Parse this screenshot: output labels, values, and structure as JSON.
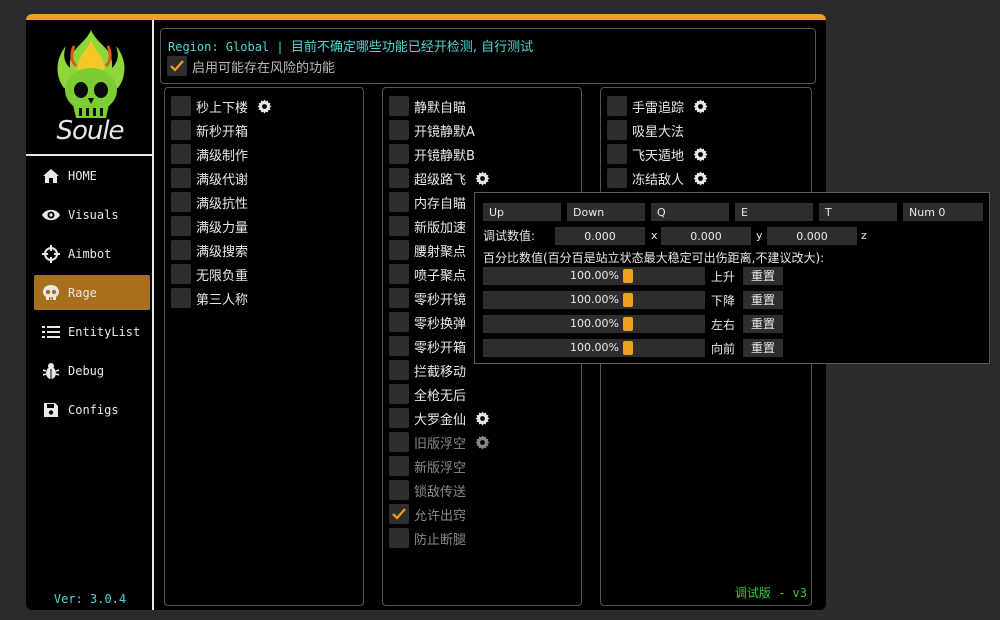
{
  "app": {
    "logo_text": "Soule",
    "version": "Ver: 3.0.4",
    "accent_color": "#f0a020",
    "cyan_color": "#4fd6d6"
  },
  "nav": [
    {
      "label": "HOME",
      "icon": "home-icon",
      "active": false
    },
    {
      "label": "Visuals",
      "icon": "eye-icon",
      "active": false
    },
    {
      "label": "Aimbot",
      "icon": "crosshair-icon",
      "active": false
    },
    {
      "label": "Rage",
      "icon": "skull-icon",
      "active": true
    },
    {
      "label": "EntityList",
      "icon": "list-icon",
      "active": false
    },
    {
      "label": "Debug",
      "icon": "bug-icon",
      "active": false
    },
    {
      "label": "Configs",
      "icon": "save-icon",
      "active": false
    }
  ],
  "header": {
    "region": "Region: Global",
    "separator": " | ",
    "notice": "目前不确定哪些功能已经开检测, 自行测试",
    "risk_label": "启用可能存在风险的功能",
    "risk_checked": true
  },
  "col1": [
    {
      "label": "秒上下楼",
      "gear": true
    },
    {
      "label": "新秒开箱"
    },
    {
      "label": "满级制作"
    },
    {
      "label": "满级代谢"
    },
    {
      "label": "满级抗性"
    },
    {
      "label": "满级力量"
    },
    {
      "label": "满级搜索"
    },
    {
      "label": "无限负重"
    },
    {
      "label": "第三人称"
    }
  ],
  "col2": [
    {
      "label": "静默自瞄"
    },
    {
      "label": "开镜静默A"
    },
    {
      "label": "开镜静默B"
    },
    {
      "label": "超级路飞",
      "gear": true
    },
    {
      "label": "内存自瞄"
    },
    {
      "label": "新版加速"
    },
    {
      "label": "腰射聚点"
    },
    {
      "label": "喷子聚点"
    },
    {
      "label": "零秒开镜"
    },
    {
      "label": "零秒换弹"
    },
    {
      "label": "零秒开箱"
    },
    {
      "label": "拦截移动"
    },
    {
      "label": "全枪无后"
    },
    {
      "label": "大罗金仙",
      "gear": true
    },
    {
      "label": "旧版浮空",
      "gear": true,
      "disabled": true
    },
    {
      "label": "新版浮空",
      "disabled": true
    },
    {
      "label": "锁敌传送",
      "disabled": true
    },
    {
      "label": "允许出窍",
      "disabled": true,
      "checked": true
    },
    {
      "label": "防止断腿",
      "disabled": true
    }
  ],
  "col3": [
    {
      "label": "手雷追踪",
      "gear": true
    },
    {
      "label": "吸星大法"
    },
    {
      "label": "飞天遁地",
      "gear": true
    },
    {
      "label": "冻结敌人",
      "gear": true
    }
  ],
  "col3_footer": "调试版 - v3",
  "popup": {
    "keys": [
      "Up",
      "Down",
      "Q",
      "E",
      "T",
      "Num 0"
    ],
    "debug_label": "调试数值:",
    "debug_values": [
      {
        "value": "0.000",
        "axis": "x"
      },
      {
        "value": "0.000",
        "axis": "y"
      },
      {
        "value": "0.000",
        "axis": "z"
      }
    ],
    "percent_label": "百分比数值(百分百是站立状态最大稳定可出伤距离,不建议改大):",
    "rows": [
      {
        "value": "100.00%",
        "label": "上升",
        "reset": "重置",
        "level": 0.0
      },
      {
        "value": "100.00%",
        "label": "下降",
        "reset": "重置",
        "level": 0.0
      },
      {
        "value": "100.00%",
        "label": "左右",
        "reset": "重置",
        "level": 0.0
      },
      {
        "value": "100.00%",
        "label": "向前",
        "reset": "重置",
        "level": 0.0
      }
    ]
  }
}
